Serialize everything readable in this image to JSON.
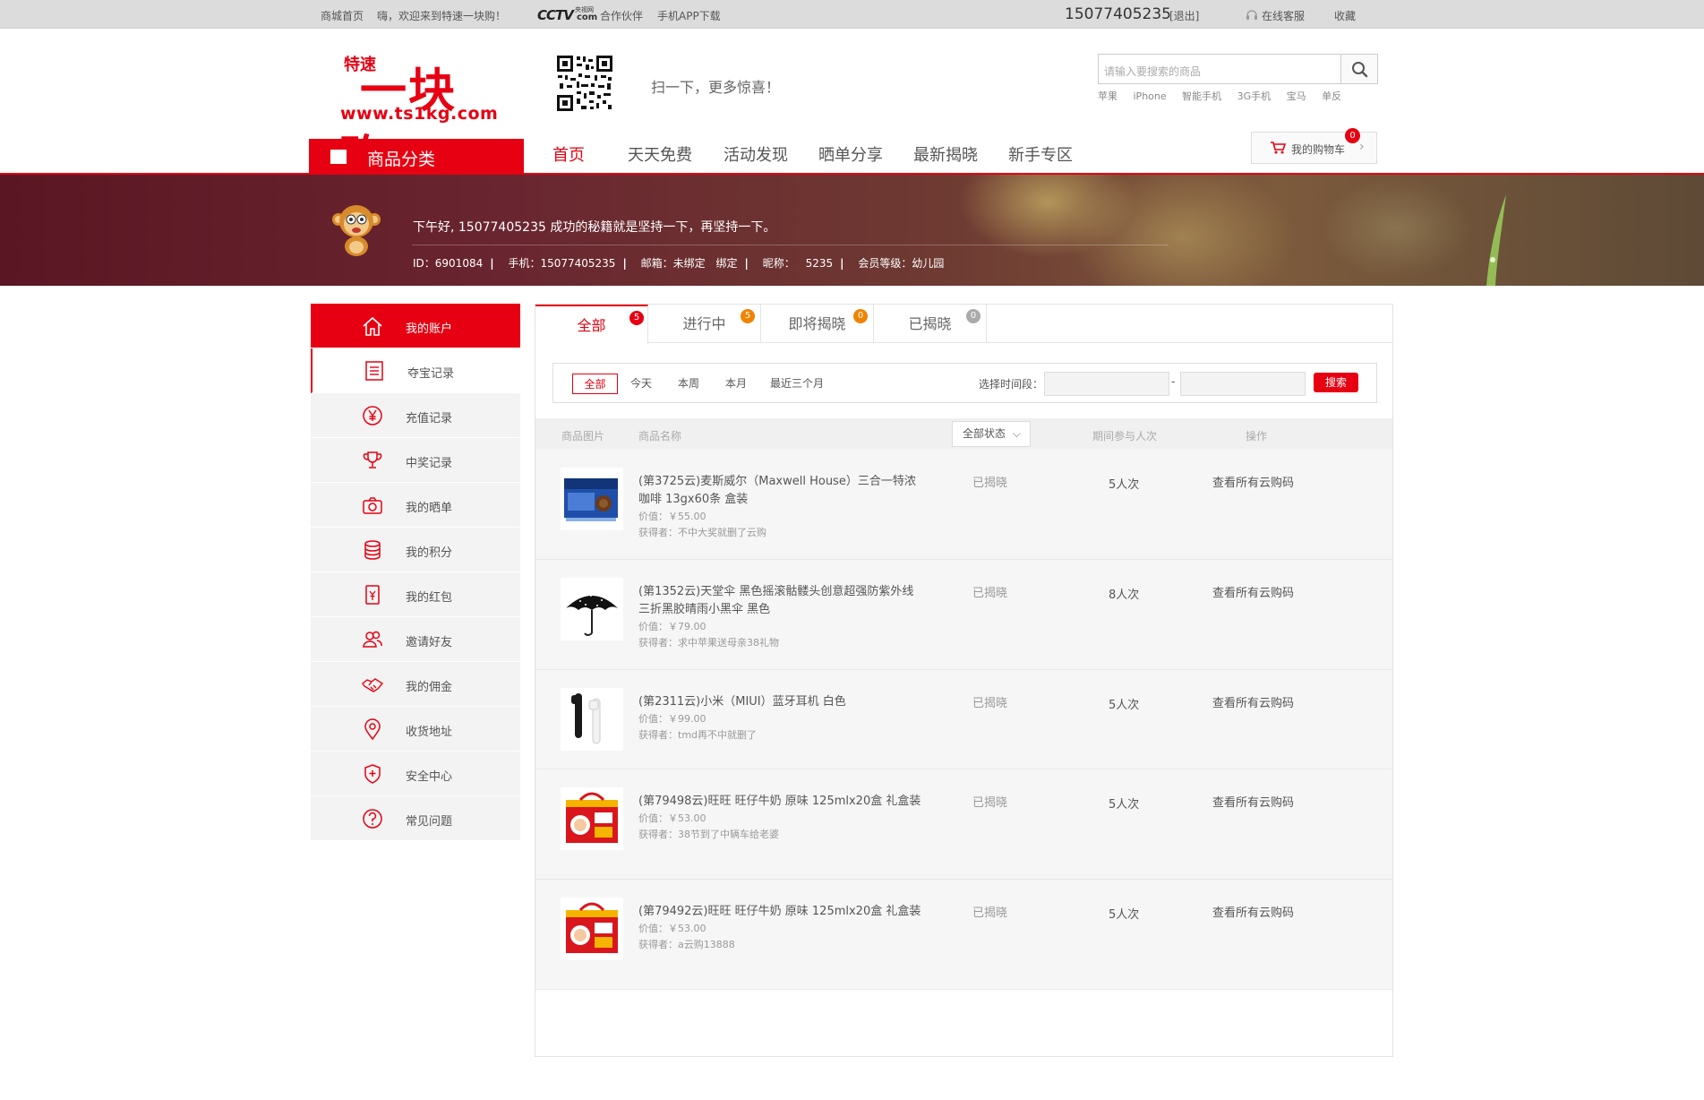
{
  "topbar": {
    "home": "商城首页",
    "welcome": "嗨，欢迎来到特速一块购！",
    "partner": "合作伙伴",
    "app": "手机APP下载",
    "phone": "15077405235",
    "logout": "[退出]",
    "service": "在线客服",
    "favorite": "收藏",
    "cctv_small": "央视网",
    "cctv_big": "CCTV",
    "cctv_com": "com"
  },
  "header": {
    "logo_small": "特速",
    "logo_main": "一块购",
    "logo_url": "www.ts1kg.com",
    "qr_text": "扫一下，更多惊喜！",
    "search_placeholder": "请输入要搜索的商品",
    "hotwords": [
      "苹果",
      "iPhone",
      "智能手机",
      "3G手机",
      "宝马",
      "单反"
    ]
  },
  "nav": {
    "category": "商品分类",
    "items": [
      "首页",
      "天天免费",
      "活动发现",
      "晒单分享",
      "最新揭晓",
      "新手专区"
    ],
    "cart_label": "我的购物车",
    "cart_count": "0"
  },
  "banner": {
    "greeting": "下午好, 15077405235 成功的秘籍就是坚持一下，再坚持一下。",
    "id": "ID：6901084",
    "phone": "手机：15077405235",
    "email": "邮箱：未绑定",
    "bind": "绑定",
    "nickname": "昵称：",
    "nickname_val": "5235",
    "level": "会员等级：幼儿园",
    "separator": "|"
  },
  "sidebar": {
    "items": [
      {
        "label": "我的账户",
        "icon": "home-icon"
      },
      {
        "label": "夺宝记录",
        "icon": "list-icon"
      },
      {
        "label": "充值记录",
        "icon": "yen-icon"
      },
      {
        "label": "中奖记录",
        "icon": "trophy-icon"
      },
      {
        "label": "我的晒单",
        "icon": "camera-icon"
      },
      {
        "label": "我的积分",
        "icon": "coins-icon"
      },
      {
        "label": "我的红包",
        "icon": "redpacket-icon"
      },
      {
        "label": "邀请好友",
        "icon": "friends-icon"
      },
      {
        "label": "我的佣金",
        "icon": "handshake-icon"
      },
      {
        "label": "收货地址",
        "icon": "location-icon"
      },
      {
        "label": "安全中心",
        "icon": "shield-icon"
      },
      {
        "label": "常见问题",
        "icon": "question-icon"
      }
    ]
  },
  "tabs": [
    {
      "label": "全部",
      "count": "5",
      "color": "#e60012"
    },
    {
      "label": "进行中",
      "count": "5",
      "color": "#f08300"
    },
    {
      "label": "即将揭晓",
      "count": "0",
      "color": "#f08300"
    },
    {
      "label": "已揭晓",
      "count": "0",
      "color": "#aaaaaa"
    }
  ],
  "filter": {
    "ranges": [
      "全部",
      "今天",
      "本周",
      "本月",
      "最近三个月"
    ],
    "date_label": "选择时间段：",
    "dash": "-",
    "search": "搜索"
  },
  "table": {
    "headers": [
      "商品图片",
      "商品名称",
      "全部状态",
      "期间参与人次",
      "操作"
    ],
    "price_prefix": "价值：",
    "winner_prefix": "获得者：",
    "rows": [
      {
        "name": "(第3725云)麦斯威尔（Maxwell House）三合一特浓咖啡 13gx60条 盒装",
        "price": "￥55.00",
        "winner": "不中大奖就删了云购",
        "status": "已揭晓",
        "count": "5人次",
        "op": "查看所有云购码",
        "img": "coffee-box"
      },
      {
        "name": "(第1352云)天堂伞 黑色摇滚骷髅头创意超强防紫外线三折黑胶晴雨小黑伞 黑色",
        "price": "￥79.00",
        "winner": "求中苹果送母亲38礼物",
        "status": "已揭晓",
        "count": "8人次",
        "op": "查看所有云购码",
        "img": "umbrella"
      },
      {
        "name": "(第2311云)小米（MIUI）蓝牙耳机 白色",
        "price": "￥99.00",
        "winner": "tmd再不中就删了",
        "status": "已揭晓",
        "count": "5人次",
        "op": "查看所有云购码",
        "img": "earphone"
      },
      {
        "name": "(第79498云)旺旺 旺仔牛奶 原味 125mlx20盒 礼盒装",
        "price": "￥53.00",
        "winner": "38节到了中辆车给老婆",
        "status": "已揭晓",
        "count": "5人次",
        "op": "查看所有云购码",
        "img": "milk-gift-box"
      },
      {
        "name": "(第79492云)旺旺 旺仔牛奶 原味 125mlx20盒 礼盒装",
        "price": "￥53.00",
        "winner": "a云购13888",
        "status": "已揭晓",
        "count": "5人次",
        "op": "查看所有云购码",
        "img": "milk-gift-box"
      }
    ]
  },
  "colors": {
    "brand": "#e60012",
    "orange": "#f08300"
  }
}
